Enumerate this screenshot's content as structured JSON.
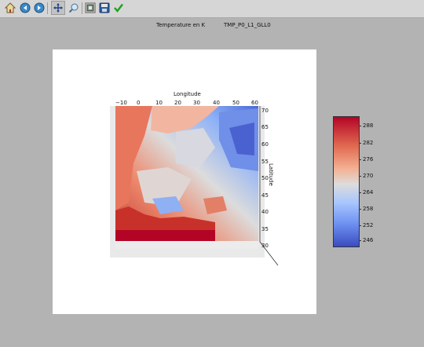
{
  "toolbar": {
    "tools": [
      {
        "name": "home-icon",
        "label": "Home"
      },
      {
        "name": "back-icon",
        "label": "Back"
      },
      {
        "name": "forward-icon",
        "label": "Forward"
      },
      {
        "name": "pan-icon",
        "label": "Pan"
      },
      {
        "name": "zoom-icon",
        "label": "Zoom"
      },
      {
        "name": "subplots-icon",
        "label": "Configure subplots"
      },
      {
        "name": "save-icon",
        "label": "Save"
      },
      {
        "name": "check-icon",
        "label": "Apply"
      }
    ]
  },
  "header": {
    "title_left": "Temperature en K",
    "title_right": "TMP_P0_L1_GLL0"
  },
  "plot": {
    "xlabel": "Longitude",
    "ylabel": "Latitude",
    "x_ticks": [
      "−10",
      "0",
      "10",
      "20",
      "30",
      "40",
      "50",
      "60"
    ],
    "y_ticks": [
      "70",
      "65",
      "60",
      "55",
      "50",
      "45",
      "40",
      "35",
      "30"
    ],
    "colorbar": {
      "ticks": [
        "288",
        "282",
        "276",
        "270",
        "264",
        "258",
        "252",
        "246"
      ],
      "colors": [
        "#b40426",
        "#e0684f",
        "#f3b194",
        "#dddcdc",
        "#a9c6fd",
        "#6f92f3",
        "#3b4cc0"
      ]
    }
  }
}
